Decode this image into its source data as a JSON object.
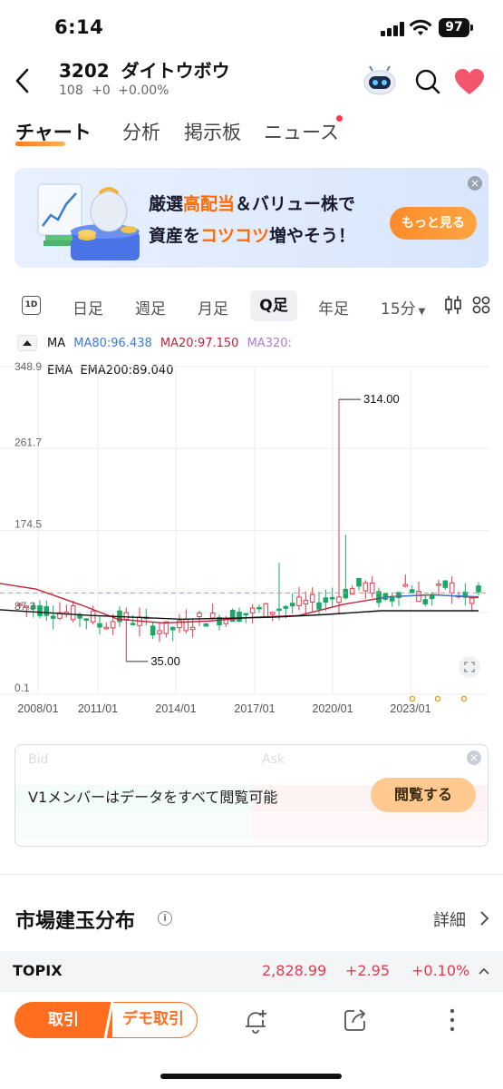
{
  "status_bar": {
    "time": "6:14",
    "battery": "97"
  },
  "header": {
    "code": "3202",
    "name": "ダイトウボウ",
    "price": "108",
    "change": "+0",
    "change_pct": "+0.00%"
  },
  "tabs": [
    "チャート",
    "分析",
    "掲示板",
    "ニュース"
  ],
  "banner": {
    "line1_a": "厳選",
    "line1_b": "高配当",
    "line1_c": "＆バリュー株で",
    "line2_a": "資産を",
    "line2_b": "コツコツ",
    "line2_c": "増やそう！",
    "cta": "もっと見る",
    "close": "×"
  },
  "periods": {
    "icon": "1D",
    "daily": "日足",
    "weekly": "週足",
    "monthly": "月足",
    "quarterly": "Q足",
    "yearly": "年足",
    "minute": "15分"
  },
  "indicators": {
    "ma_label": "MA",
    "ma80": "MA80:96.438",
    "ma20": "MA20:97.150",
    "ma320": "MA320:",
    "ema_label": "EMA",
    "ema200": "EMA200:89.040"
  },
  "colors": {
    "up": "#e03a4e",
    "down": "#1aa866",
    "ma80": "#3a7bd5",
    "ma20": "#c0243a",
    "ma320": "#b07ad6",
    "ema200": "#111111",
    "accent": "#ff6d1f"
  },
  "chart_data": {
    "type": "candlestick",
    "y_ticks": [
      "348.9",
      "261.7",
      "174.5",
      "87.3",
      "0.1"
    ],
    "x_ticks": [
      "2008/01",
      "2011/01",
      "2014/01",
      "2017/01",
      "2020/01",
      "2023/01"
    ],
    "max_label": "314.00",
    "min_label": "35.00",
    "current_price": 108,
    "ylim": [
      0.1,
      348.9
    ]
  },
  "data_box": {
    "bid": "Bid",
    "ask": "Ask",
    "message": "V1メンバーはデータをすべて閲覧可能",
    "button": "閲覧する",
    "close": "×"
  },
  "section": {
    "title": "市場建玉分布",
    "info": "i",
    "detail": "詳細"
  },
  "index_row": {
    "name": "TOPIX",
    "value": "2,828.99",
    "change": "+2.95",
    "pct": "+0.10%"
  },
  "bottom_bar": {
    "trade": "取引",
    "demo": "デモ取引"
  }
}
